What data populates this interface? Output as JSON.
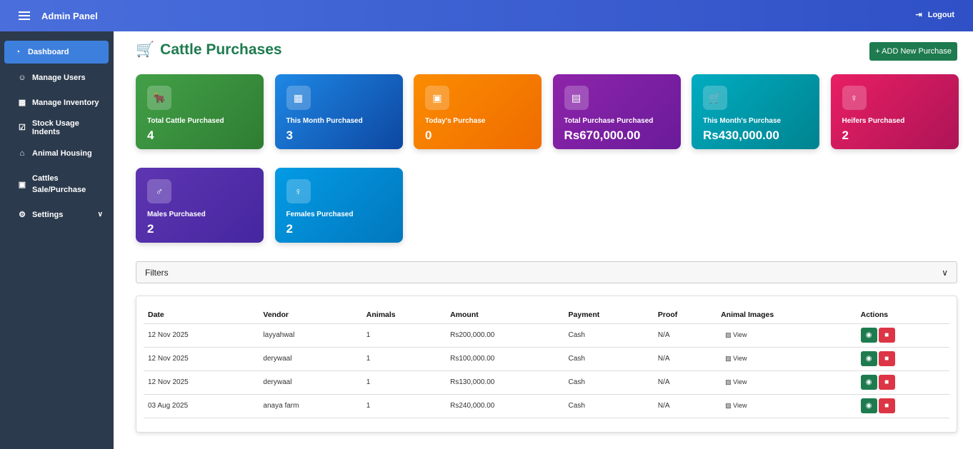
{
  "header": {
    "title": "Admin Panel",
    "logout": "Logout"
  },
  "sidebar": {
    "items": [
      {
        "label": "Dashboard",
        "icon": "gauge-icon"
      },
      {
        "label": "Manage Users",
        "icon": "users-cog-icon"
      },
      {
        "label": "Manage Inventory",
        "icon": "boxes-icon"
      },
      {
        "label": "Stock Usage Indents",
        "icon": "clipboard-check-icon"
      },
      {
        "label": "Animal Housing",
        "icon": "home-icon"
      },
      {
        "label": "Cattles Sale/Purchase",
        "icon": "money-icon"
      },
      {
        "label": "Settings",
        "icon": "cogs-icon"
      }
    ]
  },
  "page": {
    "title": "Cattle Purchases",
    "add_button": "+ ADD New Purchase",
    "filters": "Filters"
  },
  "stats": [
    {
      "label": "Total Cattle Purchased",
      "value": "4",
      "icon": "cow-icon",
      "color": "#43a047"
    },
    {
      "label": "This Month Purchased",
      "value": "3",
      "icon": "calendar-icon",
      "color": "#1e88e5"
    },
    {
      "label": "Today's Purchase",
      "value": "0",
      "icon": "calendar-day-icon",
      "color": "#fb8c00"
    },
    {
      "label": "Total Purchase Purchased",
      "value": "Rs670,000.00",
      "icon": "money-bill-icon",
      "color": "#8e24aa"
    },
    {
      "label": "This Month's Purchase",
      "value": "Rs430,000.00",
      "icon": "cart-icon",
      "color": "#00acc1"
    },
    {
      "label": "Heifers Purchased",
      "value": "2",
      "icon": "venus-icon",
      "color": "#e91e63"
    },
    {
      "label": "Males Purchased",
      "value": "2",
      "icon": "mars-icon",
      "color": "#5e35b1"
    },
    {
      "label": "Females Purchased",
      "value": "2",
      "icon": "venus-icon",
      "color": "#039be5"
    }
  ],
  "table": {
    "headers": [
      "Date",
      "Vendor",
      "Animals",
      "Amount",
      "Payment",
      "Proof",
      "Animal Images",
      "Actions"
    ],
    "view_label": "View",
    "rows": [
      [
        "12 Nov 2025",
        "layyahwal",
        "1",
        "Rs200,000.00",
        "Cash",
        "N/A"
      ],
      [
        "12 Nov 2025",
        "derywaal",
        "1",
        "Rs100,000.00",
        "Cash",
        "N/A"
      ],
      [
        "12 Nov 2025",
        "derywaal",
        "1",
        "Rs130,000.00",
        "Cash",
        "N/A"
      ],
      [
        "03 Aug 2025",
        "anaya farm",
        "1",
        "Rs240,000.00",
        "Cash",
        "N/A"
      ]
    ]
  }
}
